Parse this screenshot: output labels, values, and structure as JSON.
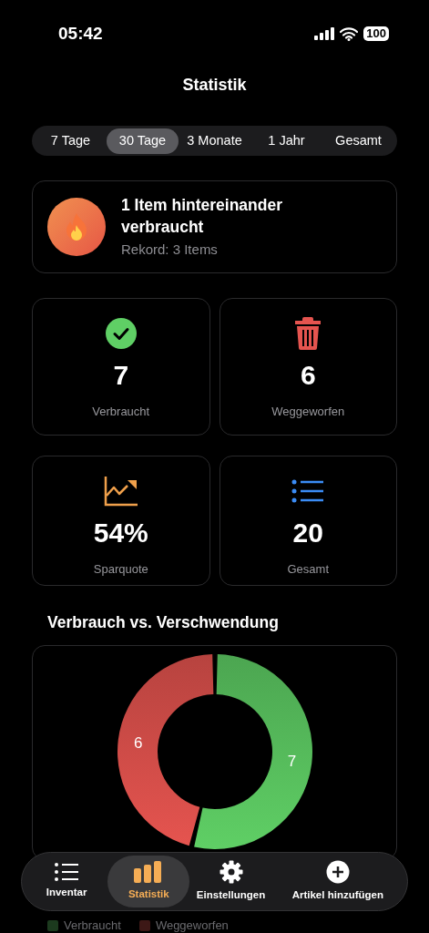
{
  "status_bar": {
    "time": "05:42",
    "battery": "100"
  },
  "title": "Statistik",
  "periods": [
    {
      "label": "7 Tage",
      "selected": false
    },
    {
      "label": "30 Tage",
      "selected": true
    },
    {
      "label": "3 Monate",
      "selected": false
    },
    {
      "label": "1 Jahr",
      "selected": false
    },
    {
      "label": "Gesamt",
      "selected": false
    }
  ],
  "streak": {
    "title": "1 Item hintereinander verbraucht",
    "subtitle": "Rekord: 3 Items"
  },
  "stats": [
    {
      "kind": "consumed",
      "value": "7",
      "label": "Verbraucht"
    },
    {
      "kind": "discarded",
      "value": "6",
      "label": "Weggeworfen"
    },
    {
      "kind": "savings",
      "value": "54%",
      "label": "Sparquote"
    },
    {
      "kind": "total",
      "value": "20",
      "label": "Gesamt"
    }
  ],
  "chart_section": {
    "title": "Verbrauch vs. Verschwendung",
    "chart_data": {
      "type": "donut",
      "categories": [
        "Verbraucht",
        "Weggeworfen"
      ],
      "values": [
        7,
        6
      ],
      "data_labels": true
    }
  },
  "legend": [
    {
      "color": "#1c3a1e"
    },
    {
      "color": "#3d1816"
    }
  ],
  "tab_bar": [
    {
      "kind": "list",
      "label": "Inventar",
      "selected": false
    },
    {
      "kind": "chart",
      "label": "Statistik",
      "selected": true
    },
    {
      "kind": "gear",
      "label": "Einstellungen",
      "selected": false
    },
    {
      "kind": "plus",
      "label": "Artikel hinzufügen",
      "selected": false
    }
  ]
}
